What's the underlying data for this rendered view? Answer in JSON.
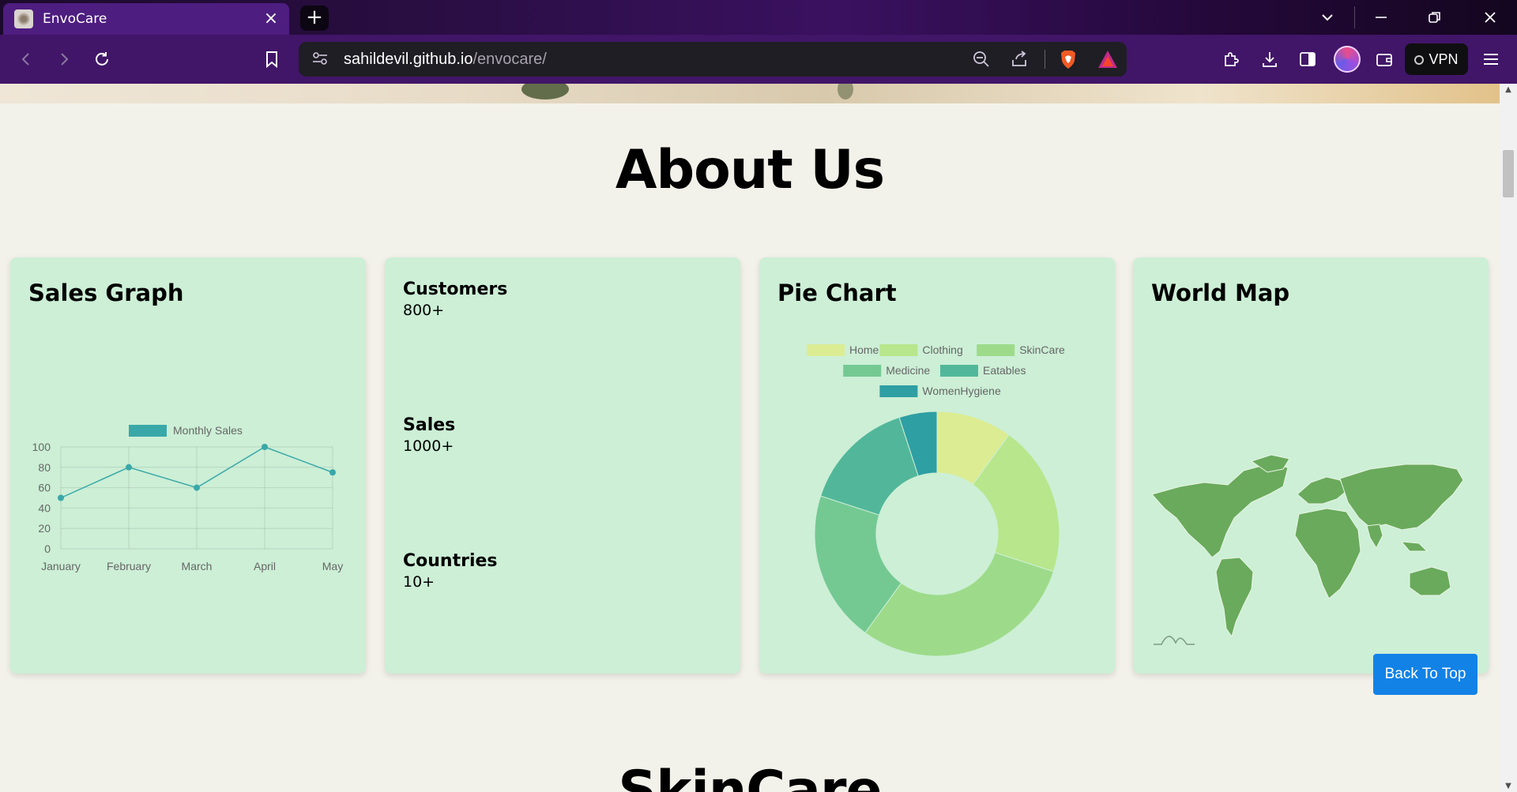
{
  "browser": {
    "tab_title": "EnvoCare",
    "tab_close": "×",
    "new_tab": "+",
    "url_host": "sahildevil.github.io",
    "url_path": "/envocare/",
    "vpn_label": "VPN"
  },
  "page": {
    "about_title": "About Us",
    "next_section_title": "SkinCare",
    "back_to_top": "Back To Top"
  },
  "cards": {
    "sales_graph": {
      "title": "Sales Graph"
    },
    "stats": {
      "items": [
        {
          "label": "Customers",
          "value": "800+"
        },
        {
          "label": "Sales",
          "value": "1000+"
        },
        {
          "label": "Countries",
          "value": "10+"
        }
      ]
    },
    "pie_chart": {
      "title": "Pie Chart"
    },
    "world_map": {
      "title": "World Map"
    }
  },
  "colors": {
    "card_bg": "#ccefd6",
    "accent_teal": "#3aa8a8",
    "back_to_top_bg": "#1282e6"
  },
  "chart_data": [
    {
      "type": "line",
      "x": [
        "January",
        "February",
        "March",
        "April",
        "May"
      ],
      "series": [
        {
          "name": "Monthly Sales",
          "values": [
            50,
            80,
            60,
            100,
            75
          ]
        }
      ],
      "ylim": [
        0,
        100
      ],
      "yticks": [
        0,
        20,
        40,
        60,
        80,
        100
      ],
      "legend": "top",
      "grid": true
    },
    {
      "type": "pie",
      "labels": [
        "Home",
        "Clothing",
        "SkinCare",
        "Medicine",
        "Eatables",
        "WomenHygiene"
      ],
      "values": [
        10,
        20,
        30,
        20,
        15,
        5
      ],
      "colors": [
        "#dcec92",
        "#b8e68c",
        "#9ddb8a",
        "#74c992",
        "#52b79a",
        "#2e9fa3"
      ],
      "legend": "top"
    }
  ]
}
